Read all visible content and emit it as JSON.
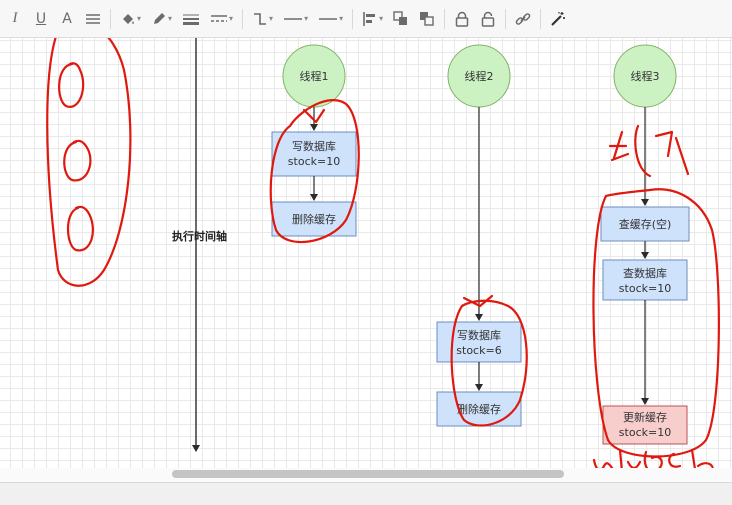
{
  "toolbar": {
    "buttons": [
      {
        "name": "italic-button",
        "icon": "italic-icon",
        "glyph": "I"
      },
      {
        "name": "underline-button",
        "icon": "underline-icon",
        "glyph": "U"
      },
      {
        "name": "font-color-button",
        "icon": "font-color-icon",
        "glyph": "A"
      },
      {
        "name": "align-button",
        "icon": "align-icon"
      },
      {
        "name": "fill-color-button",
        "icon": "paint-bucket-icon"
      },
      {
        "name": "line-color-button",
        "icon": "pencil-icon"
      },
      {
        "name": "line-width-button",
        "icon": "line-width-icon"
      },
      {
        "name": "line-style-button",
        "icon": "dashed-line-icon"
      },
      {
        "name": "connector-style-button",
        "icon": "elbow-connector-icon"
      },
      {
        "name": "start-arrow-button",
        "icon": "line-start-icon"
      },
      {
        "name": "end-arrow-button",
        "icon": "line-end-icon"
      },
      {
        "name": "align-shapes-button",
        "icon": "align-left-icon"
      },
      {
        "name": "bring-front-button",
        "icon": "bring-to-front-icon"
      },
      {
        "name": "send-back-button",
        "icon": "send-to-back-icon"
      },
      {
        "name": "lock-button",
        "icon": "lock-icon"
      },
      {
        "name": "unlock-button",
        "icon": "unlock-icon"
      },
      {
        "name": "link-button",
        "icon": "link-icon"
      },
      {
        "name": "magic-button",
        "icon": "magic-wand-icon"
      }
    ]
  },
  "diagram": {
    "timeline_label": "执行时间轴",
    "threads": [
      {
        "name": "thread-1",
        "label": "线程1"
      },
      {
        "name": "thread-2",
        "label": "线程2"
      },
      {
        "name": "thread-3",
        "label": "线程3"
      }
    ],
    "boxes": {
      "t1_write": [
        "写数据库",
        "stock=10"
      ],
      "t1_delete": [
        "删除缓存"
      ],
      "t2_write": [
        "写数据库",
        "stock=6"
      ],
      "t2_delete": [
        "删除缓存"
      ],
      "t3_query": [
        "查缓存(空)"
      ],
      "t3_read": [
        "查数据库",
        "stock=10"
      ],
      "t3_update": [
        "更新缓存",
        "stock=10"
      ]
    },
    "annotations": {
      "lock_text": "锁",
      "unlock_text": "unlock"
    },
    "colors": {
      "thread_fill": "#ccf2c4",
      "box_fill": "#cfe2fb",
      "box_stroke": "#6c8ebf",
      "update_fill": "#f8cecc",
      "update_stroke": "#b85450",
      "ink": "#e0190e"
    }
  }
}
